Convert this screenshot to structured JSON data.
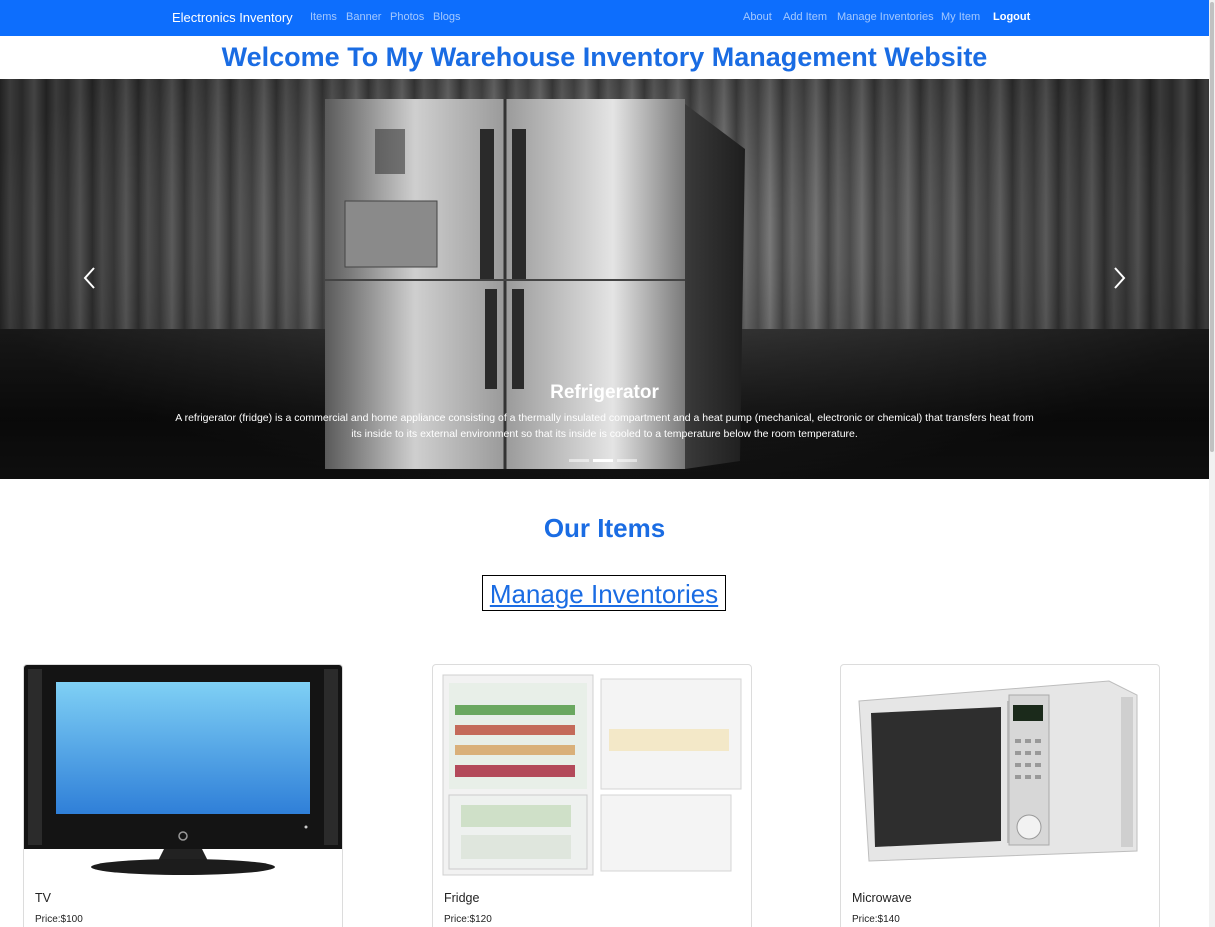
{
  "navbar": {
    "brand": "Electronics Inventory",
    "left_links": [
      "Items",
      "Banner",
      "Photos",
      "Blogs"
    ],
    "right_links": [
      "About",
      "Add Item",
      "Manage Inventories",
      "My Item"
    ],
    "logout": "Logout",
    "color": "#0d6efd"
  },
  "page_title": "Welcome To My Warehouse Inventory Management Website",
  "carousel": {
    "prev_icon": "chevron-left-icon",
    "next_icon": "chevron-right-icon",
    "caption_title": "Refrigerator",
    "caption_text": "A refrigerator (fridge) is a commercial and home appliance consisting of a thermally insulated compartment and a heat pump (mechanical, electronic or chemical) that transfers heat from its inside to its external environment so that its inside is cooled to a temperature below the room temperature.",
    "slide_count": 3,
    "active_slide": 2
  },
  "items_section": {
    "title": "Our Items",
    "manage_link": "Manage Inventories"
  },
  "items": [
    {
      "name": "TV",
      "price": "Price:$100"
    },
    {
      "name": "Fridge",
      "price": "Price:$120"
    },
    {
      "name": "Microwave",
      "price": "Price:$140"
    }
  ],
  "accent_color": "#1a6ce3"
}
